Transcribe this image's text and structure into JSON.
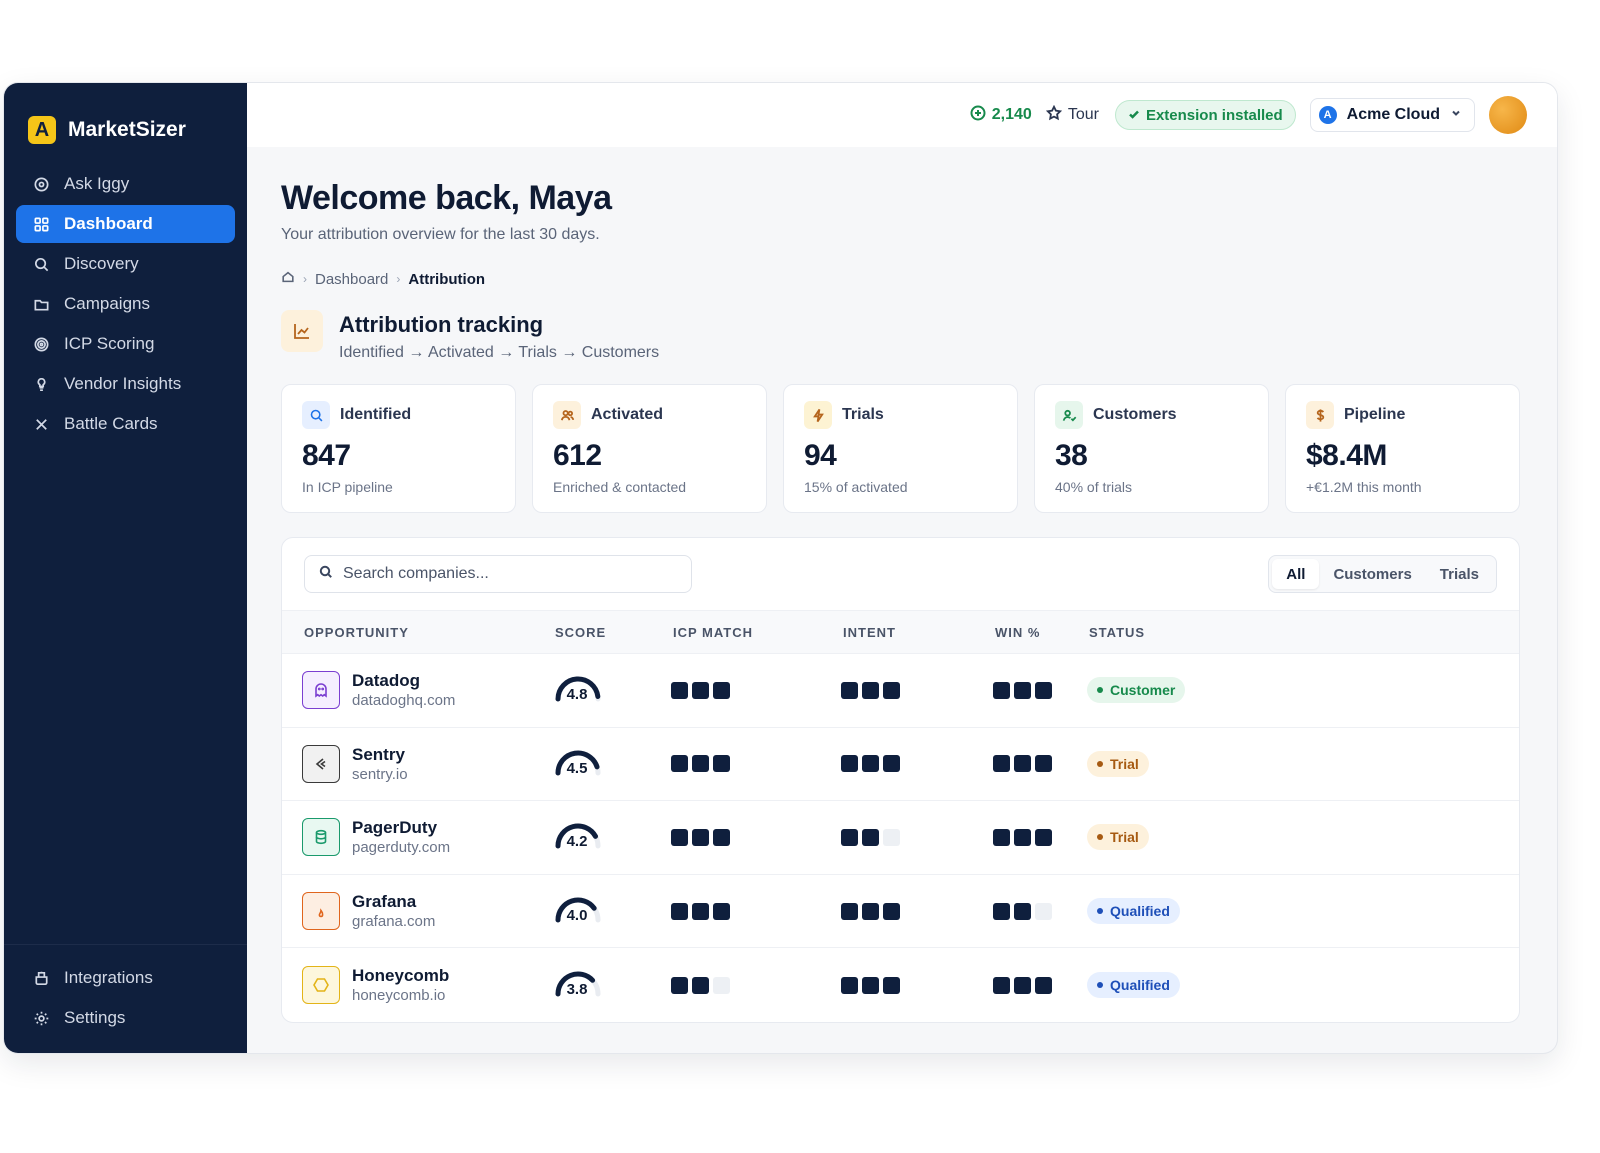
{
  "brand": {
    "name": "MarketSizer",
    "logo_letter": "A",
    "logo_color": "#f5c518"
  },
  "sidebar": {
    "items": [
      {
        "label": "Ask Iggy",
        "icon": "sparkle-icon",
        "active": false
      },
      {
        "label": "Dashboard",
        "icon": "grid-icon",
        "active": true
      },
      {
        "label": "Discovery",
        "icon": "search-icon",
        "active": false
      },
      {
        "label": "Campaigns",
        "icon": "folder-icon",
        "active": false
      },
      {
        "label": "ICP Scoring",
        "icon": "target-icon",
        "active": false
      },
      {
        "label": "Vendor Insights",
        "icon": "bulb-icon",
        "active": false
      },
      {
        "label": "Battle Cards",
        "icon": "swords-icon",
        "active": false
      }
    ],
    "bottom_items": [
      {
        "label": "Integrations",
        "icon": "plug-icon"
      },
      {
        "label": "Settings",
        "icon": "gear-icon"
      }
    ],
    "bg_color": "#0f1f3d",
    "active_color": "#1e73e8"
  },
  "topbar": {
    "credits": "2,140",
    "tour_label": "Tour",
    "extension_label": "Extension installed",
    "workspace": {
      "logo_letter": "A",
      "name": "Acme Cloud"
    }
  },
  "header": {
    "title": "Welcome back, Maya",
    "subtitle": "Your attribution overview for the last 30 days."
  },
  "breadcrumb": {
    "items": [
      "Dashboard",
      "Attribution"
    ]
  },
  "section": {
    "title": "Attribution tracking",
    "subtitle": "Identified → Activated → Trials → Customers"
  },
  "kpis": [
    {
      "label": "Identified",
      "value": "847",
      "note": "In ICP pipeline",
      "icon": "search-icon",
      "icon_bg": "#e6efff",
      "icon_color": "#1e73e8"
    },
    {
      "label": "Activated",
      "value": "612",
      "note": "Enriched & contacted",
      "icon": "users-icon",
      "icon_bg": "#fdf1dc",
      "icon_color": "#b5651d"
    },
    {
      "label": "Trials",
      "value": "94",
      "note": "15% of activated",
      "icon": "bolt-icon",
      "icon_bg": "#fdf3d3",
      "icon_color": "#b5651d"
    },
    {
      "label": "Customers",
      "value": "38",
      "note": "40% of trials",
      "icon": "user-check-icon",
      "icon_bg": "#e6f6ec",
      "icon_color": "#178a4c"
    },
    {
      "label": "Pipeline",
      "value": "$8.4M",
      "note": "+€1.2M this month",
      "icon": "dollar-icon",
      "icon_bg": "#fdf1dc",
      "icon_color": "#b5651d"
    }
  ],
  "table": {
    "search_placeholder": "Search companies...",
    "filters": [
      {
        "label": "All",
        "active": true
      },
      {
        "label": "Customers",
        "active": false
      },
      {
        "label": "Trials",
        "active": false
      }
    ],
    "columns": [
      "OPPORTUNITY",
      "SCORE",
      "ICP MATCH",
      "INTENT",
      "WIN %",
      "STATUS"
    ],
    "rows": [
      {
        "name": "Datadog",
        "domain": "datadoghq.com",
        "logo": "ghost-icon",
        "logo_color": "#7b3fd1",
        "logo_bg": "#f5efff",
        "score": "4.8",
        "score_value": 4.8,
        "icp": 3,
        "intent": 3,
        "win": 3,
        "status": "Customer",
        "status_kind": "customer"
      },
      {
        "name": "Sentry",
        "domain": "sentry.io",
        "logo": "sentry-icon",
        "logo_color": "#3a3a3a",
        "logo_bg": "#f1f1f1",
        "score": "4.5",
        "score_value": 4.5,
        "icp": 3,
        "intent": 3,
        "win": 3,
        "status": "Trial",
        "status_kind": "trial"
      },
      {
        "name": "PagerDuty",
        "domain": "pagerduty.com",
        "logo": "database-icon",
        "logo_color": "#1a9a6c",
        "logo_bg": "#e8f8f1",
        "score": "4.2",
        "score_value": 4.2,
        "icp": 3,
        "intent": 2,
        "win": 3,
        "status": "Trial",
        "status_kind": "trial"
      },
      {
        "name": "Grafana",
        "domain": "grafana.com",
        "logo": "flame-icon",
        "logo_color": "#e0651d",
        "logo_bg": "#fdeee2",
        "score": "4.0",
        "score_value": 4.0,
        "icp": 3,
        "intent": 3,
        "win": 2,
        "status": "Qualified",
        "status_kind": "qualified"
      },
      {
        "name": "Honeycomb",
        "domain": "honeycomb.io",
        "logo": "hexagon-icon",
        "logo_color": "#e3b418",
        "logo_bg": "#fdf7dd",
        "score": "3.8",
        "score_value": 3.8,
        "icp": 2,
        "intent": 3,
        "win": 3,
        "status": "Qualified",
        "status_kind": "qualified"
      }
    ],
    "status_colors": {
      "customer": {
        "bg": "#e6f6ec",
        "fg": "#178a4c"
      },
      "trial": {
        "bg": "#fdf1dc",
        "fg": "#a65a12"
      },
      "qualified": {
        "bg": "#e6efff",
        "fg": "#1e4fb8"
      }
    }
  }
}
